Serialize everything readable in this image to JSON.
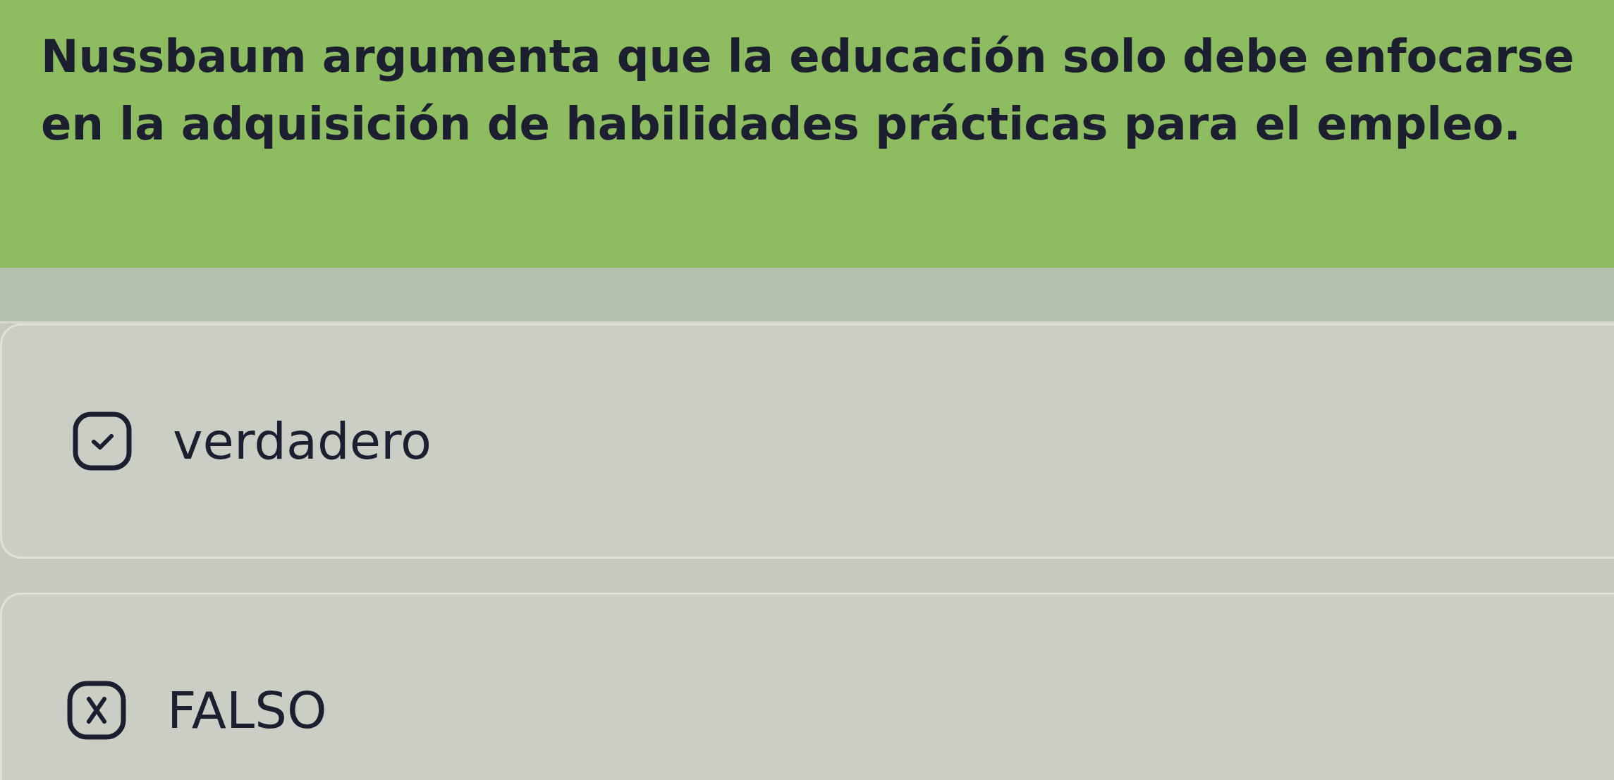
{
  "question": {
    "text": "Nussbaum argumenta que la educación solo debe enfocarse en la adquisición de habilidades prácticas para el empleo."
  },
  "options": [
    {
      "label": "verdadero",
      "kind": "check"
    },
    {
      "label": "FALSO",
      "kind": "cross"
    }
  ]
}
